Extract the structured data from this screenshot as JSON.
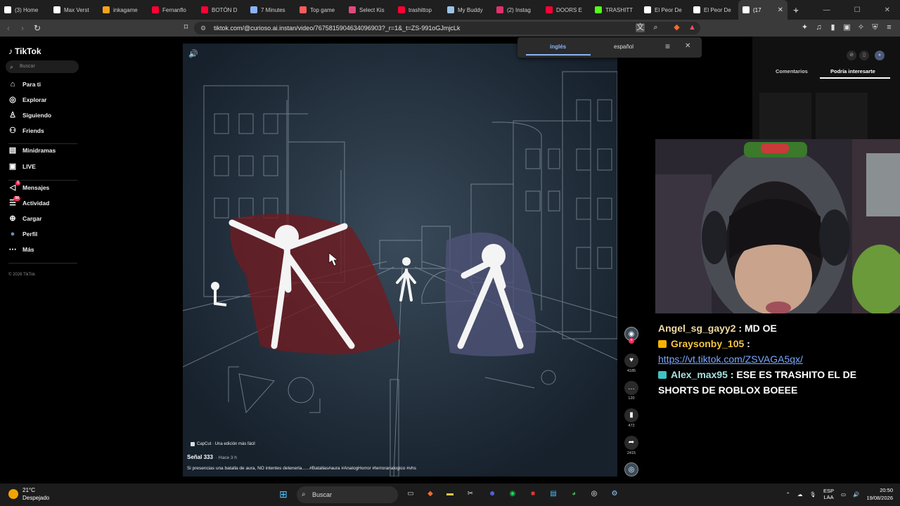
{
  "browser": {
    "tabs": [
      {
        "label": "(3) Home",
        "icon": "x-icon",
        "color": "#ffffff"
      },
      {
        "label": "Max Verst",
        "icon": "tiktok-icon",
        "color": "#ffffff"
      },
      {
        "label": "inkagame",
        "icon": "inkagames-icon",
        "color": "#f7a21b"
      },
      {
        "label": "Fernanflo",
        "icon": "youtube-icon",
        "color": "#ff0033"
      },
      {
        "label": "BOTÓN D",
        "icon": "youtube-icon",
        "color": "#ff0033"
      },
      {
        "label": "7 Minutes",
        "icon": "page-icon",
        "color": "#8ab4f8"
      },
      {
        "label": "Top game",
        "icon": "itch-icon",
        "color": "#fa5c5c"
      },
      {
        "label": "Select Kis",
        "icon": "app-icon",
        "color": "#e04a7a"
      },
      {
        "label": "trashittop",
        "icon": "youtube-icon",
        "color": "#ff0033"
      },
      {
        "label": "My Buddy",
        "icon": "image-icon",
        "color": "#9cc3e6"
      },
      {
        "label": "(2) Instag",
        "icon": "instagram-icon",
        "color": "#e1306c"
      },
      {
        "label": "DOORS E",
        "icon": "youtube-icon",
        "color": "#ff0033"
      },
      {
        "label": "TRASHITT",
        "icon": "kick-icon",
        "color": "#53fc18"
      },
      {
        "label": "El Peor De",
        "icon": "tiktok-icon",
        "color": "#ffffff"
      },
      {
        "label": "El Peor De",
        "icon": "tiktok-icon",
        "color": "#ffffff"
      },
      {
        "label": "(17",
        "icon": "tiktok-icon",
        "color": "#ffffff",
        "active": true
      }
    ],
    "url": "tiktok.com/@curioso.ai.instan/video/7675815904634096903?_r=1&_t=ZS-991oGJmjcLk"
  },
  "translate_popup": {
    "lang_from": "inglés",
    "lang_to": "español"
  },
  "tiktok": {
    "logo": "TikTok",
    "search_placeholder": "Buscar",
    "nav": [
      {
        "label": "Para ti",
        "icon": "home-icon"
      },
      {
        "label": "Explorar",
        "icon": "compass-icon"
      },
      {
        "label": "Siguiendo",
        "icon": "following-icon"
      },
      {
        "label": "Friends",
        "icon": "friends-icon"
      },
      {
        "label": "Minidramas",
        "icon": "minidramas-icon"
      },
      {
        "label": "LIVE",
        "icon": "live-icon"
      },
      {
        "label": "Mensajes",
        "icon": "messages-icon",
        "badge": "1"
      },
      {
        "label": "Actividad",
        "icon": "activity-icon",
        "badge": "56"
      },
      {
        "label": "Cargar",
        "icon": "upload-icon"
      },
      {
        "label": "Perfil",
        "icon": "profile-icon"
      },
      {
        "label": "Más",
        "icon": "more-icon"
      }
    ],
    "copyright": "© 2026 TikTok",
    "video": {
      "capcut": "CapCut · Una edición más fácil",
      "author": "Señal 333",
      "posted": "· Hace 3 h",
      "description": "Si presencias una batalla de aura, NO intentes detenerla......#Batallas#aura #AnalogHorror #terroranalogico #vhs"
    },
    "actions": {
      "likes": "4185",
      "comments": "120",
      "saves": "472",
      "shares": "2415"
    },
    "right_tabs": [
      "Comentarios",
      "Podría interesarte"
    ]
  },
  "chat": {
    "messages": [
      {
        "user": "Angel_sg_gayy2",
        "sep": " : ",
        "text": "MD OE"
      },
      {
        "user": "Graysonby_105",
        "sep": " :",
        "text": "https://vt.tiktok.com/ZSVAGA5qx/"
      },
      {
        "user": "Alex_max95",
        "sep": " : ",
        "text": "ESE ES TRASHITO EL DE SHORTS DE ROBLOX BOEEE"
      }
    ]
  },
  "taskbar": {
    "temp": "21°C",
    "weather": "Despejado",
    "search": "Buscar",
    "lang1": "ESP",
    "lang2": "LAA",
    "time": "20:50",
    "date": "19/08/2026"
  }
}
